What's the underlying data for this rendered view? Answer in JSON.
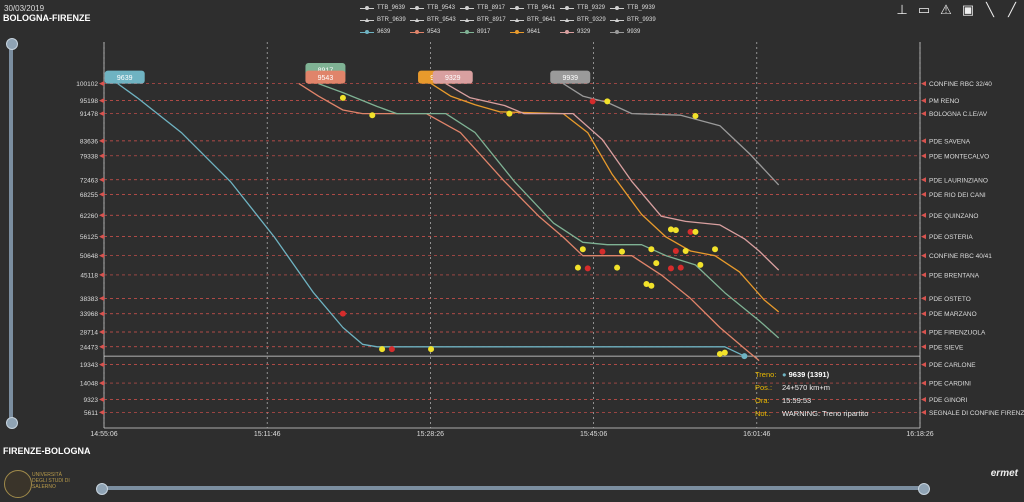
{
  "header": {
    "date": "30/03/2019",
    "route_top": "BOLOGNA-FIRENZE",
    "route_bottom": "FIRENZE-BOLOGNA"
  },
  "toolbar": [
    {
      "name": "reset-zoom-icon",
      "glyph": "⊥"
    },
    {
      "name": "ruler-icon",
      "glyph": "▭"
    },
    {
      "name": "warning-icon",
      "glyph": "⚠"
    },
    {
      "name": "train-icon",
      "glyph": "▣"
    },
    {
      "name": "line-tool-icon",
      "glyph": "╲"
    },
    {
      "name": "diagonal-tool-icon",
      "glyph": "╱"
    }
  ],
  "legend": {
    "rows": [
      [
        "TTB_9639",
        "TTB_9543",
        "TTB_8917",
        "TTB_9641",
        "TTB_9329",
        "TTB_9939"
      ],
      [
        "BTR_9639",
        "BTR_9543",
        "BTR_8917",
        "BTR_9641",
        "BTR_9329",
        "BTR_9939"
      ],
      [
        "9639",
        "9543",
        "8917",
        "9641",
        "9329",
        "9939"
      ]
    ],
    "colors": [
      "#6fb3c2",
      "#e0846a",
      "#7fb294",
      "#e89a2c",
      "#d9a0a0",
      "#9a9a9a"
    ]
  },
  "chart_data": {
    "type": "line",
    "title": "",
    "xlabel": "",
    "ylabel": "",
    "x_ticks": [
      "14:55:06",
      "15:11:46",
      "15:28:26",
      "15:45:06",
      "16:01:46",
      "16:18:26"
    ],
    "x_range": [
      "14:55:06",
      "16:18:26"
    ],
    "stations": [
      {
        "km": 100102,
        "name": "CONFINE RBC 32/40"
      },
      {
        "km": 95198,
        "name": "PM RENO"
      },
      {
        "km": 91478,
        "name": "BOLOGNA C.LE/AV"
      },
      {
        "km": 83636,
        "name": "PDE SAVENA"
      },
      {
        "km": 79338,
        "name": "PDE MONTECALVO"
      },
      {
        "km": 72463,
        "name": "PDE LAURINZIANO"
      },
      {
        "km": 68255,
        "name": "PDE RIO DEI CANI"
      },
      {
        "km": 62260,
        "name": "PDE QUINZANO"
      },
      {
        "km": 56125,
        "name": "PDE OSTERIA"
      },
      {
        "km": 50648,
        "name": "CONFINE RBC 40/41"
      },
      {
        "km": 45118,
        "name": "PDE BRENTANA"
      },
      {
        "km": 38383,
        "name": "PDE OSTETO"
      },
      {
        "km": 33968,
        "name": "PDE MARZANO"
      },
      {
        "km": 28714,
        "name": "PDE FIRENZUOLA"
      },
      {
        "km": 24473,
        "name": "PDE SIEVE"
      },
      {
        "km": 19343,
        "name": "PDE CARLONE"
      },
      {
        "km": 14048,
        "name": "PDE CARDINI"
      },
      {
        "km": 9323,
        "name": "PDE GINORI"
      },
      {
        "km": 5611,
        "name": "SEGNALE DI CONFINE FIRENZE C"
      }
    ],
    "y_range": [
      2000,
      104000
    ],
    "grid": true,
    "series": [
      {
        "name": "9639",
        "color": "#6fb3c2",
        "points": [
          [
            "14:56:30",
            100102
          ],
          [
            "14:58:30",
            96000
          ],
          [
            "15:03:00",
            86000
          ],
          [
            "15:08:00",
            72000
          ],
          [
            "15:12:30",
            56000
          ],
          [
            "15:16:30",
            40000
          ],
          [
            "15:19:30",
            30000
          ],
          [
            "15:21:30",
            25200
          ],
          [
            "15:23:00",
            24473
          ],
          [
            "15:40:00",
            24473
          ],
          [
            "15:58:30",
            24473
          ],
          [
            "16:00:30",
            21800
          ]
        ]
      },
      {
        "name": "9543",
        "color": "#e0846a",
        "points": [
          [
            "15:15:00",
            100102
          ],
          [
            "15:17:00",
            96500
          ],
          [
            "15:19:30",
            92500
          ],
          [
            "15:21:30",
            91478
          ],
          [
            "15:28:00",
            91478
          ],
          [
            "15:31:30",
            86000
          ],
          [
            "15:36:00",
            72000
          ],
          [
            "15:39:30",
            62000
          ],
          [
            "15:42:00",
            56000
          ],
          [
            "15:44:00",
            50648
          ],
          [
            "15:47:00",
            50648
          ],
          [
            "15:49:00",
            50648
          ],
          [
            "15:52:00",
            45118
          ],
          [
            "15:55:00",
            38383
          ],
          [
            "15:58:00",
            30000
          ],
          [
            "16:00:30",
            24000
          ],
          [
            "16:02:00",
            20500
          ]
        ]
      },
      {
        "name": "8917",
        "color": "#7fb294",
        "points": [
          [
            "15:17:00",
            100102
          ],
          [
            "15:19:30",
            97500
          ],
          [
            "15:23:00",
            93500
          ],
          [
            "15:25:00",
            91478
          ],
          [
            "15:30:00",
            91478
          ],
          [
            "15:33:00",
            86000
          ],
          [
            "15:37:00",
            72000
          ],
          [
            "15:41:00",
            60000
          ],
          [
            "15:44:00",
            54500
          ],
          [
            "15:46:30",
            53800
          ],
          [
            "15:50:00",
            53800
          ],
          [
            "15:52:30",
            50648
          ],
          [
            "15:55:30",
            48000
          ],
          [
            "15:58:30",
            40000
          ],
          [
            "16:02:00",
            32000
          ],
          [
            "16:04:00",
            27000
          ]
        ]
      },
      {
        "name": "9641",
        "color": "#e89a2c",
        "points": [
          [
            "15:28:30",
            100102
          ],
          [
            "15:30:30",
            96500
          ],
          [
            "15:33:00",
            94000
          ],
          [
            "15:35:30",
            92000
          ],
          [
            "15:42:00",
            91478
          ],
          [
            "15:44:30",
            86000
          ],
          [
            "15:47:00",
            74000
          ],
          [
            "15:50:00",
            62500
          ],
          [
            "15:52:30",
            56000
          ],
          [
            "15:55:00",
            52000
          ],
          [
            "15:57:30",
            50648
          ],
          [
            "16:00:00",
            46000
          ],
          [
            "16:02:30",
            38000
          ],
          [
            "16:04:00",
            34500
          ]
        ]
      },
      {
        "name": "9329",
        "color": "#d9a0a0",
        "points": [
          [
            "15:30:00",
            100102
          ],
          [
            "15:32:30",
            96000
          ],
          [
            "15:36:00",
            93800
          ],
          [
            "15:38:00",
            91478
          ],
          [
            "15:43:00",
            91478
          ],
          [
            "15:46:00",
            84000
          ],
          [
            "15:49:00",
            72000
          ],
          [
            "15:52:00",
            62000
          ],
          [
            "15:54:30",
            60500
          ],
          [
            "15:58:00",
            59500
          ],
          [
            "16:00:30",
            55500
          ],
          [
            "16:02:00",
            52000
          ],
          [
            "16:04:00",
            46500
          ]
        ]
      },
      {
        "name": "9939",
        "color": "#9a9a9a",
        "points": [
          [
            "15:42:00",
            100102
          ],
          [
            "15:44:00",
            96500
          ],
          [
            "15:46:30",
            94700
          ],
          [
            "15:49:00",
            91478
          ],
          [
            "15:54:00",
            91000
          ],
          [
            "15:58:00",
            88000
          ],
          [
            "16:01:00",
            80000
          ],
          [
            "16:04:00",
            71000
          ]
        ]
      }
    ],
    "train_labels": [
      {
        "text": "9639",
        "time": "14:56:30",
        "km": 101800,
        "color": "#6fb3c2"
      },
      {
        "text": "8917",
        "time": "15:17:00",
        "km": 104000,
        "color": "#7fb294"
      },
      {
        "text": "9543",
        "time": "15:17:00",
        "km": 101800,
        "color": "#e0846a"
      },
      {
        "text": "9641",
        "time": "15:28:30",
        "km": 101800,
        "color": "#e89a2c"
      },
      {
        "text": "9329",
        "time": "15:30:00",
        "km": 101800,
        "color": "#d9a0a0"
      },
      {
        "text": "9939",
        "time": "15:42:00",
        "km": 101800,
        "color": "#9a9a9a"
      }
    ],
    "event_markers": [
      {
        "time": "15:19:30",
        "km": 96000,
        "kind": "yellow"
      },
      {
        "time": "15:22:30",
        "km": 91000,
        "kind": "yellow"
      },
      {
        "time": "15:36:30",
        "km": 91478,
        "kind": "yellow"
      },
      {
        "time": "15:45:00",
        "km": 95000,
        "kind": "red"
      },
      {
        "time": "15:46:30",
        "km": 95000,
        "kind": "yellow"
      },
      {
        "time": "15:55:30",
        "km": 90800,
        "kind": "yellow"
      },
      {
        "time": "15:19:30",
        "km": 34000,
        "kind": "red"
      },
      {
        "time": "15:23:30",
        "km": 23800,
        "kind": "yellow"
      },
      {
        "time": "15:24:30",
        "km": 23800,
        "kind": "red"
      },
      {
        "time": "15:28:30",
        "km": 23800,
        "kind": "yellow"
      },
      {
        "time": "15:53:00",
        "km": 58200,
        "kind": "yellow"
      },
      {
        "time": "15:53:30",
        "km": 58000,
        "kind": "yellow"
      },
      {
        "time": "15:55:00",
        "km": 57500,
        "kind": "red"
      },
      {
        "time": "15:55:30",
        "km": 57500,
        "kind": "yellow"
      },
      {
        "time": "15:44:00",
        "km": 52500,
        "kind": "yellow"
      },
      {
        "time": "15:46:00",
        "km": 51800,
        "kind": "red"
      },
      {
        "time": "15:48:00",
        "km": 51800,
        "kind": "yellow"
      },
      {
        "time": "15:51:00",
        "km": 52500,
        "kind": "yellow"
      },
      {
        "time": "15:53:30",
        "km": 52000,
        "kind": "red"
      },
      {
        "time": "15:54:30",
        "km": 52000,
        "kind": "yellow"
      },
      {
        "time": "15:57:30",
        "km": 52500,
        "kind": "yellow"
      },
      {
        "time": "15:43:30",
        "km": 47200,
        "kind": "yellow"
      },
      {
        "time": "15:44:30",
        "km": 47000,
        "kind": "red"
      },
      {
        "time": "15:47:30",
        "km": 47200,
        "kind": "yellow"
      },
      {
        "time": "15:51:30",
        "km": 48500,
        "kind": "yellow"
      },
      {
        "time": "15:53:00",
        "km": 47000,
        "kind": "red"
      },
      {
        "time": "15:54:00",
        "km": 47200,
        "kind": "red"
      },
      {
        "time": "15:56:00",
        "km": 48000,
        "kind": "yellow"
      },
      {
        "time": "15:50:30",
        "km": 42500,
        "kind": "yellow"
      },
      {
        "time": "15:51:00",
        "km": 42000,
        "kind": "yellow"
      },
      {
        "time": "15:58:30",
        "km": 22800,
        "kind": "yellow"
      },
      {
        "time": "15:58:00",
        "km": 22400,
        "kind": "yellow"
      },
      {
        "time": "16:00:30",
        "km": 21800,
        "kind": "blue"
      }
    ]
  },
  "tooltip": {
    "train_label": "Treno:",
    "train_value": "9639 (1391)",
    "pos_label": "Pos.:",
    "pos_value": "24+570 km+m",
    "time_label": "Ora:",
    "time_value": "15:59:53",
    "note_label": "Not.:",
    "note_value": "WARNING: Treno ripartito"
  },
  "logos": {
    "university": "UNIVERSITÀ DEGLI STUDI DI SALERNO",
    "brand": "ermet"
  }
}
